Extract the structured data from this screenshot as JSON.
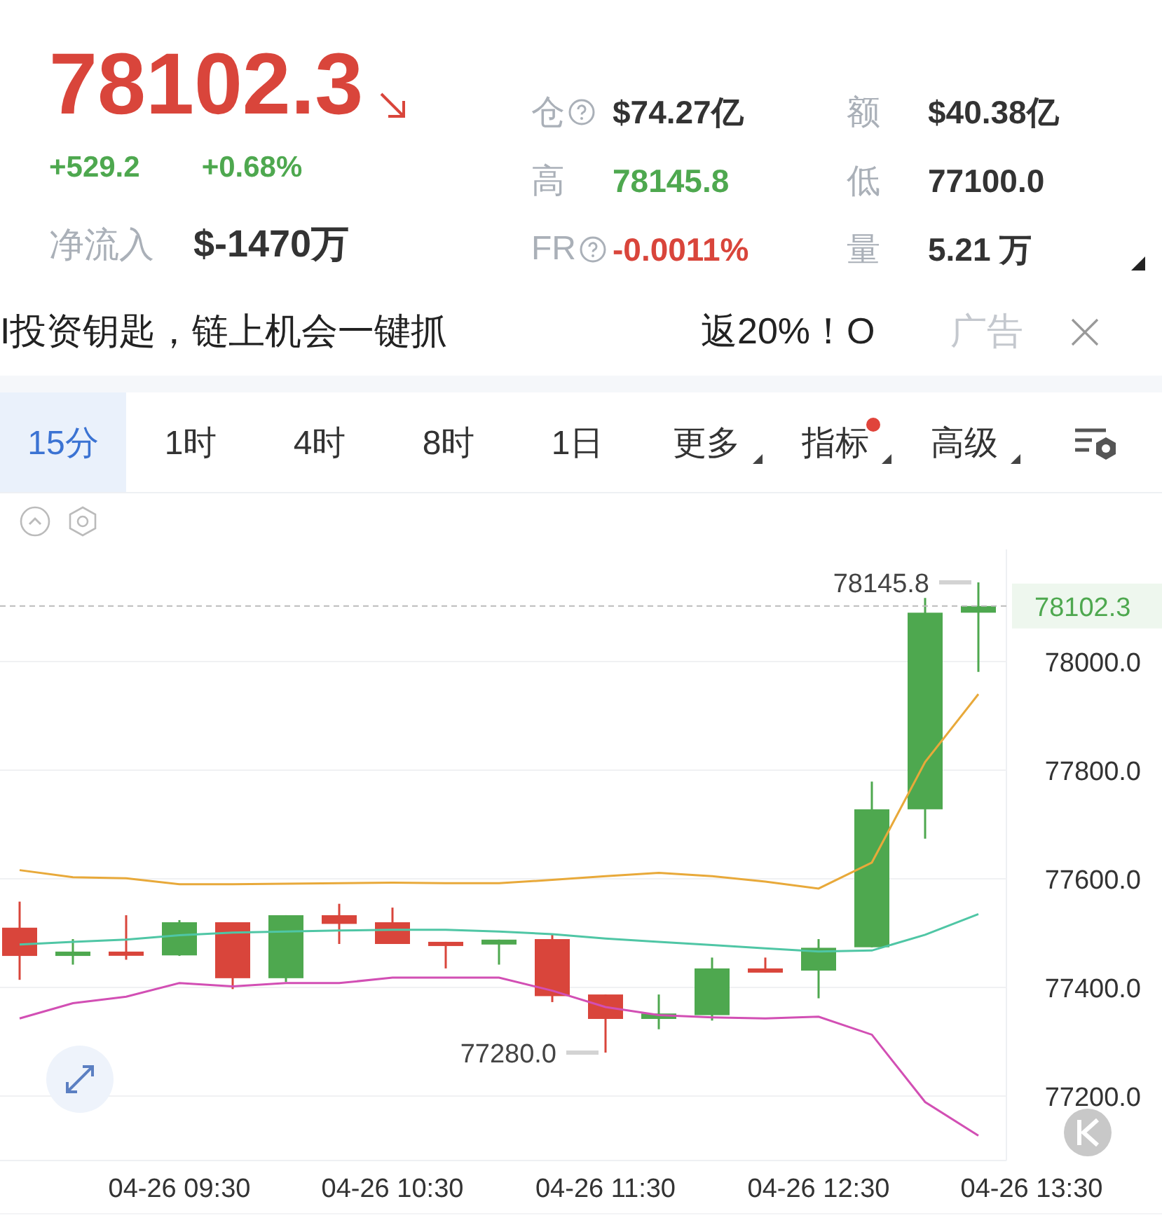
{
  "ticker": {
    "price": "78102.3",
    "color": "#d9453b",
    "change": "+529.2",
    "change_pct": "+0.68%",
    "inflow_label": "净流入",
    "inflow_value": "$-1470万"
  },
  "stats": [
    {
      "label": "仓",
      "help": true,
      "value": "$74.27亿",
      "color": "#333333"
    },
    {
      "label": "额",
      "help": false,
      "value": "$40.38亿",
      "color": "#333333"
    },
    {
      "label": "高",
      "help": false,
      "value": "78145.8",
      "color": "#4ea84f"
    },
    {
      "label": "低",
      "help": false,
      "value": "77100.0",
      "color": "#333333"
    },
    {
      "label": "FR",
      "help": true,
      "value": "-0.0011%",
      "color": "#d9453b"
    },
    {
      "label": "量",
      "help": false,
      "value": "5.21 万",
      "color": "#333333"
    }
  ],
  "ad": {
    "text": "I投资钥匙，链上机会一键抓",
    "text_right": "返20%！O",
    "tag": "广告"
  },
  "tabs": [
    {
      "label": "15分",
      "selected": true,
      "dropdown": false,
      "dot": false
    },
    {
      "label": "1时",
      "selected": false,
      "dropdown": false,
      "dot": false
    },
    {
      "label": "4时",
      "selected": false,
      "dropdown": false,
      "dot": false
    },
    {
      "label": "8时",
      "selected": false,
      "dropdown": false,
      "dot": false
    },
    {
      "label": "1日",
      "selected": false,
      "dropdown": false,
      "dot": false
    },
    {
      "label": "更多",
      "selected": false,
      "dropdown": true,
      "dot": false
    },
    {
      "label": "指标",
      "selected": false,
      "dropdown": true,
      "dot": true
    },
    {
      "label": "高级",
      "selected": false,
      "dropdown": true,
      "dot": false
    }
  ],
  "chart": {
    "price_tag": "78102.3",
    "chart_data": {
      "type": "line",
      "categories": [
        null,
        null,
        null,
        "04-26 09:30",
        null,
        null,
        null,
        "04-26 10:30",
        null,
        null,
        null,
        "04-26 11:30",
        null,
        null,
        null,
        "04-26 12:30",
        null,
        null,
        null,
        "04-26 13:30"
      ],
      "ylim": [
        77081.3,
        78206.5
      ],
      "yticks": [
        {
          "value": 77200,
          "label": "77200.0"
        },
        {
          "value": 77400,
          "label": "77400.0"
        },
        {
          "value": 77600,
          "label": "77600.0"
        },
        {
          "value": 77800,
          "label": "77800.0"
        },
        {
          "value": 78000,
          "label": "78000.0"
        }
      ],
      "series": [
        {
          "color": "#e8a93a",
          "values": [
            77616,
            77603,
            77601,
            77590,
            77590,
            77591,
            77592,
            77593,
            77592,
            77592,
            77598,
            77605,
            77611,
            77605,
            77595,
            77582,
            77630,
            77815,
            77940,
            null
          ]
        },
        {
          "color": "#4fc6a5",
          "values": [
            77479,
            77484,
            77488,
            77496,
            77501,
            77503,
            77505,
            77506,
            77506,
            77503,
            77498,
            77490,
            77484,
            77478,
            77472,
            77466,
            77468,
            77497,
            77535,
            null
          ]
        },
        {
          "color": "#d24fb4",
          "values": [
            77343,
            77371,
            77383,
            77408,
            77402,
            77408,
            77408,
            77418,
            77418,
            77418,
            77394,
            77364,
            77349,
            77345,
            77343,
            77346,
            77313,
            77189,
            77127,
            null
          ]
        },
        {
          "type": "candlestick",
          "ohlc": [
            [
              77510,
              77558,
              77414,
              77458
            ],
            [
              77458,
              77489,
              77442,
              77466
            ],
            [
              77466,
              77533,
              77451,
              77459
            ],
            [
              77459,
              77524,
              77458,
              77520
            ],
            [
              77520,
              77520,
              77397,
              77417
            ],
            [
              77417,
              77533,
              77410,
              77533
            ],
            [
              77533,
              77554,
              77480,
              77517
            ],
            [
              77520,
              77547,
              77480,
              77480
            ],
            [
              77484,
              77484,
              77435,
              77479
            ],
            [
              77479,
              77488,
              77442,
              77488
            ],
            [
              77489,
              77498,
              77373,
              77384
            ],
            [
              77387,
              77387,
              77280,
              77342
            ],
            [
              77342,
              77387,
              77323,
              77352
            ],
            [
              77349,
              77455,
              77339,
              77435
            ],
            [
              77435,
              77455,
              77428,
              77428
            ],
            [
              77431,
              77489,
              77380,
              77473
            ],
            [
              77474,
              77779,
              77474,
              77728
            ],
            [
              77728,
              78117,
              77674,
              78090
            ],
            [
              78090,
              78145.8,
              77981,
              78102.3
            ],
            null
          ]
        }
      ],
      "grid": true,
      "annotations": [
        "78145.8",
        "77280.0"
      ]
    }
  }
}
